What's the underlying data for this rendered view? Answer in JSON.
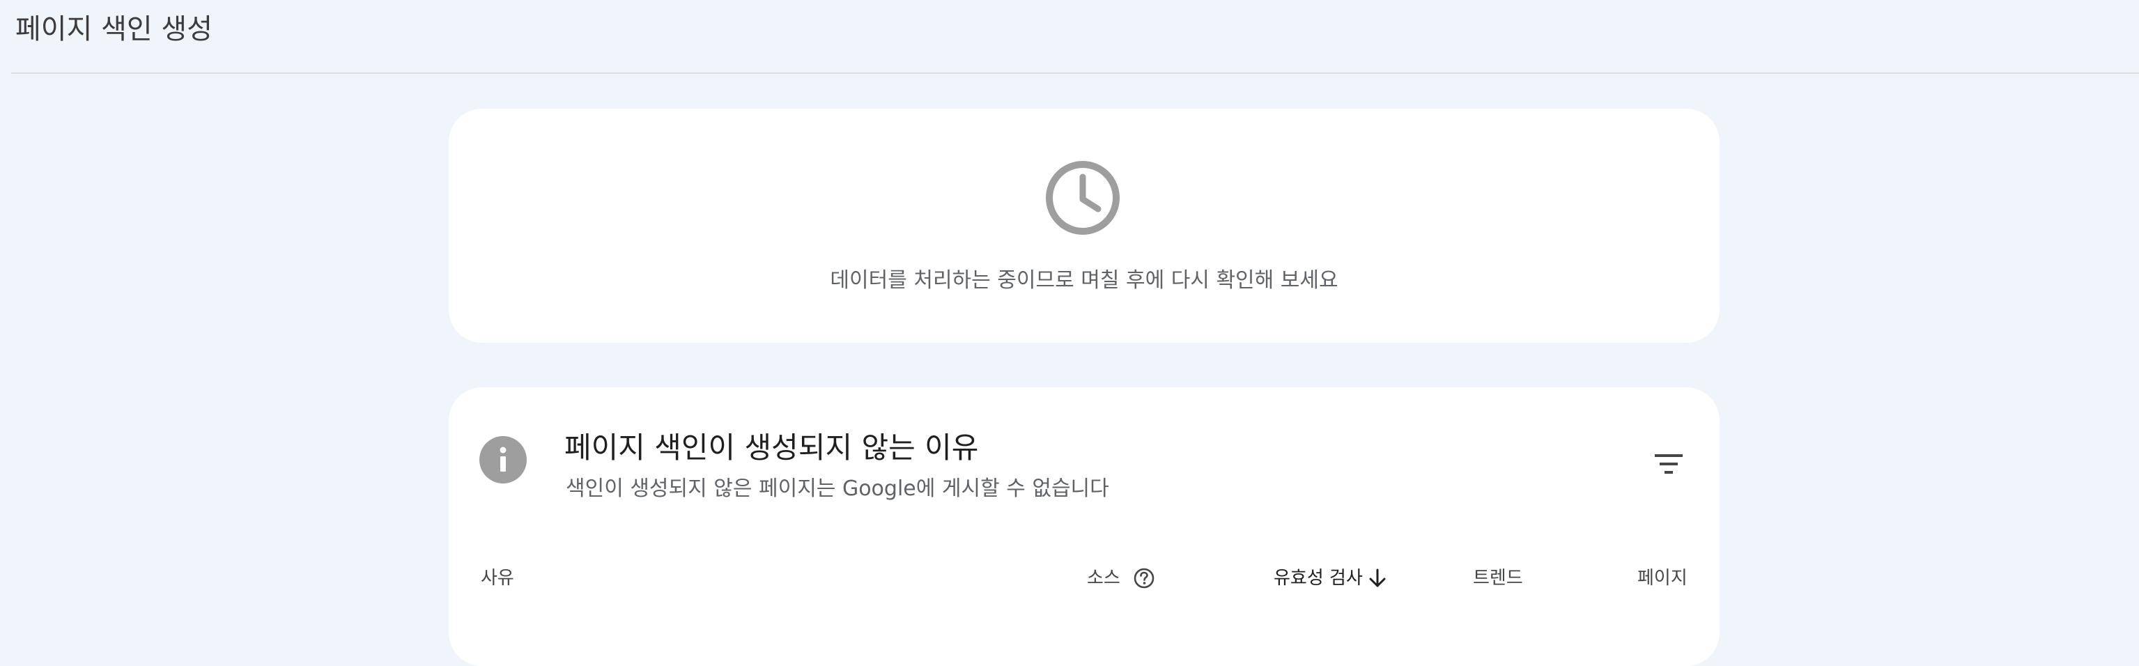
{
  "header": {
    "title": "페이지 색인 생성"
  },
  "processing_card": {
    "icon": "clock-icon",
    "message": "데이터를 처리하는 중이므로 며칠 후에 다시 확인해 보세요"
  },
  "reasons_card": {
    "icon": "info-icon",
    "title": "페이지 색인이 생성되지 않는 이유",
    "subtitle": "색인이 생성되지 않은 페이지는 Google에 게시할 수 없습니다",
    "filter_icon": "filter-icon",
    "columns": {
      "reason": "사유",
      "source": "소스",
      "validation": "유효성 검사",
      "trend": "트렌드",
      "pages": "페이지"
    },
    "help_icon": "help-circle-icon",
    "sort_icon": "arrow-down-icon"
  },
  "colors": {
    "background": "#f0f4fb",
    "card": "#ffffff",
    "icon_gray": "#9e9e9e",
    "text_secondary": "#5f6368"
  }
}
